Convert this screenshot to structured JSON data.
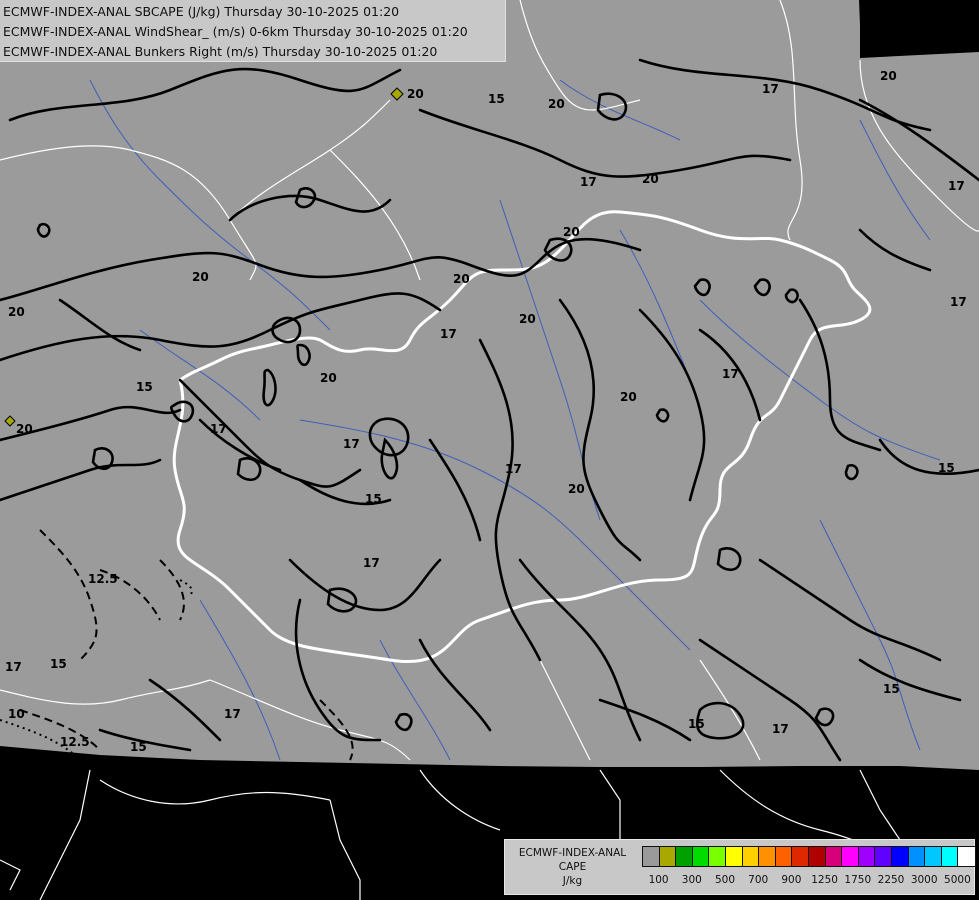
{
  "header": {
    "lines": [
      "ECMWF-INDEX-ANAL SBCAPE (J/kg) Thursday 30-10-2025 01:20",
      "ECMWF-INDEX-ANAL WindShear_ (m/s) 0-6km Thursday 30-10-2025 01:20",
      "ECMWF-INDEX-ANAL Bunkers Right (m/s) Thursday 30-10-2025 01:20"
    ]
  },
  "legend": {
    "title_lines": [
      "ECMWF-INDEX-ANAL",
      "CAPE",
      "J/kg"
    ],
    "swatch_colors": [
      "#9a9a9a",
      "#a8a800",
      "#00a000",
      "#00dc00",
      "#78ff00",
      "#ffff00",
      "#ffd000",
      "#ff9000",
      "#ff6000",
      "#e02800",
      "#b00000",
      "#d8007a",
      "#ff00ff",
      "#a000ff",
      "#6000ff",
      "#0000ff",
      "#0090ff",
      "#00c8ff",
      "#00ffff",
      "#ffffff"
    ],
    "tick_labels": [
      "100",
      "300",
      "500",
      "700",
      "900",
      "1250",
      "1750",
      "2250",
      "3000",
      "5000"
    ]
  },
  "map": {
    "contour_labels": [
      {
        "id": "c1",
        "text": "20"
      },
      {
        "id": "c2",
        "text": "15"
      },
      {
        "id": "c3",
        "text": "20"
      },
      {
        "id": "c4",
        "text": "17"
      },
      {
        "id": "c5",
        "text": "20"
      },
      {
        "id": "c6",
        "text": "17"
      },
      {
        "id": "c7",
        "text": "20"
      },
      {
        "id": "c8",
        "text": "17"
      },
      {
        "id": "c9",
        "text": "20"
      },
      {
        "id": "c10",
        "text": "20"
      },
      {
        "id": "c11",
        "text": "20"
      },
      {
        "id": "c12",
        "text": "17"
      },
      {
        "id": "c13",
        "text": "20"
      },
      {
        "id": "c14",
        "text": "17"
      },
      {
        "id": "c15",
        "text": "20"
      },
      {
        "id": "c16",
        "text": "20"
      },
      {
        "id": "c17",
        "text": "17"
      },
      {
        "id": "c18",
        "text": "20"
      },
      {
        "id": "c19",
        "text": "15"
      },
      {
        "id": "c20",
        "text": "20"
      },
      {
        "id": "c21",
        "text": "17"
      },
      {
        "id": "c22",
        "text": "15"
      },
      {
        "id": "c23",
        "text": "17"
      },
      {
        "id": "c24",
        "text": "17"
      },
      {
        "id": "c25",
        "text": "20"
      },
      {
        "id": "c26",
        "text": "15"
      },
      {
        "id": "c27",
        "text": "12.5"
      },
      {
        "id": "c28",
        "text": "17"
      },
      {
        "id": "c29",
        "text": "15"
      },
      {
        "id": "c30",
        "text": "10"
      },
      {
        "id": "c31",
        "text": "12.5"
      },
      {
        "id": "c32",
        "text": "17"
      },
      {
        "id": "c33",
        "text": "15"
      },
      {
        "id": "c34",
        "text": "15"
      },
      {
        "id": "c35",
        "text": "17"
      },
      {
        "id": "c36",
        "text": "15"
      },
      {
        "id": "c37",
        "text": "17"
      }
    ]
  }
}
